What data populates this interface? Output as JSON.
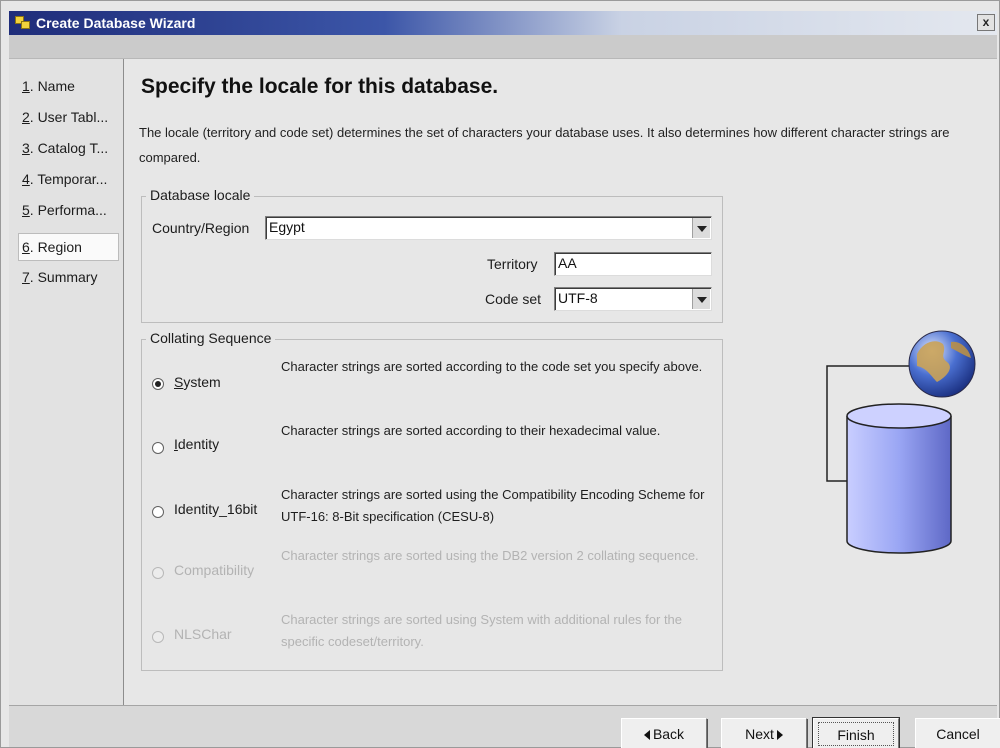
{
  "window": {
    "title": "Create Database Wizard",
    "close_label": "x"
  },
  "nav": {
    "items": [
      {
        "num": "1",
        "label": ". Name"
      },
      {
        "num": "2",
        "label": ". User Tabl..."
      },
      {
        "num": "3",
        "label": ". Catalog T..."
      },
      {
        "num": "4",
        "label": ". Temporar..."
      },
      {
        "num": "5",
        "label": ". Performa..."
      },
      {
        "num": "6",
        "label": ". Region"
      },
      {
        "num": "7",
        "label": ". Summary"
      }
    ],
    "selected_index": 5
  },
  "main": {
    "heading": "Specify the locale for this database.",
    "description": "The locale (territory and code set) determines the set of characters your database uses. It also determines how different character strings are compared."
  },
  "locale": {
    "group_title": "Database locale",
    "country_label": "Country/Region",
    "country_value": "Egypt",
    "territory_label": "Territory",
    "territory_value": "AA",
    "codeset_label": "Code set",
    "codeset_value": "UTF-8"
  },
  "collating": {
    "group_title": "Collating Sequence",
    "options": [
      {
        "label": "System",
        "desc": "Character strings are sorted according to the code set you specify above.",
        "selected": true,
        "enabled": true
      },
      {
        "label": "Identity",
        "desc": "Character strings are sorted according to their hexadecimal value.",
        "selected": false,
        "enabled": true
      },
      {
        "label": "Identity_16bit",
        "desc": "Character strings are sorted using the Compatibility Encoding Scheme for UTF-16: 8-Bit specification (CESU-8)",
        "selected": false,
        "enabled": true
      },
      {
        "label": "Compatibility",
        "desc": "Character strings are sorted using the DB2 version 2 collating sequence.",
        "selected": false,
        "enabled": false
      },
      {
        "label": "NLSChar",
        "desc": "Character strings are sorted using System with additional rules for the specific codeset/territory.",
        "selected": false,
        "enabled": false
      }
    ]
  },
  "buttons": {
    "back": "Back",
    "next": "Next",
    "finish": "Finish",
    "cancel": "Cancel"
  },
  "colors": {
    "title_start": "#1f2d7a",
    "globe_blue": "#4a6fd0",
    "cylinder": "#9aa6f4"
  },
  "icons": {
    "app": "database-wizard-icon",
    "globe": "globe-icon",
    "database": "database-cylinder-icon"
  }
}
